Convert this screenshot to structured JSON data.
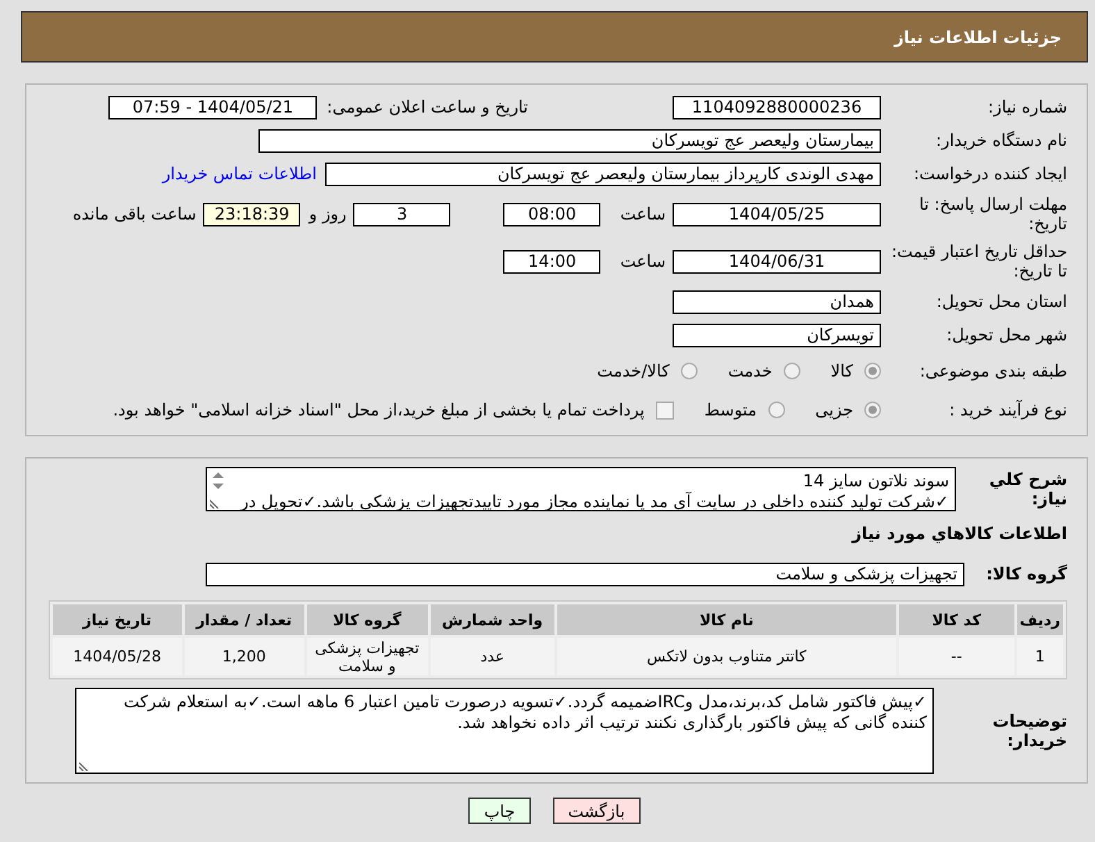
{
  "header": {
    "title": "جزئیات اطلاعات نیاز"
  },
  "need_number": {
    "label": "شماره نیاز:",
    "value": "1104092880000236"
  },
  "announce": {
    "label": "تاریخ و ساعت اعلان عمومی:",
    "value": "1404/05/21 - 07:59"
  },
  "buyer_org": {
    "label": "نام دستگاه خریدار:",
    "value": "بیمارستان ولیعصر  عج  تویسرکان"
  },
  "requester": {
    "label": "ایجاد کننده درخواست:",
    "value": "مهدی الوندی کارپرداز بیمارستان ولیعصر  عج  تویسرکان",
    "link": "اطلاعات تماس خریدار"
  },
  "reply_deadline": {
    "label": "مهلت ارسال پاسخ: تا تاریخ:",
    "date": "1404/05/25",
    "time_label": "ساعت",
    "time": "08:00",
    "days": "3",
    "days_label": "روز و",
    "remaining": "23:18:39",
    "remaining_label": "ساعت باقی مانده"
  },
  "price_validity": {
    "label": "حداقل تاریخ اعتبار قیمت: تا تاریخ:",
    "date": "1404/06/31",
    "time_label": "ساعت",
    "time": "14:00"
  },
  "province": {
    "label": "استان محل تحویل:",
    "value": "همدان"
  },
  "city": {
    "label": "شهر محل تحویل:",
    "value": "تویسرکان"
  },
  "category": {
    "label": "طبقه بندی موضوعی:",
    "options": [
      {
        "label": "کالا",
        "selected": true
      },
      {
        "label": "خدمت",
        "selected": false
      },
      {
        "label": "کالا/خدمت",
        "selected": false
      }
    ]
  },
  "purchase_process": {
    "label": "نوع فرآیند خرید :",
    "options": [
      {
        "label": "جزیی",
        "selected": true
      },
      {
        "label": "متوسط",
        "selected": false
      }
    ],
    "payment_note": {
      "checked": false,
      "text": "پرداخت تمام یا بخشی از مبلغ خرید،از محل \"اسناد خزانه اسلامی\" خواهد بود."
    }
  },
  "description": {
    "label": "شرح کلي نياز:",
    "lines": [
      "سوند نلاتون سایز 14",
      "✓شرکت تولید کننده داخلی در سایت آی مد یا نماینده مجاز مورد تاییدتجهیزات پزشکی باشد.✓تحویل در"
    ]
  },
  "goods_section": {
    "title": "اطلاعات کالاهاي مورد نياز",
    "group_label": "گروه کالا:",
    "group_value": "تجهیزات پزشکی و سلامت"
  },
  "table": {
    "columns": [
      "ردیف",
      "کد کالا",
      "نام کالا",
      "واحد شمارش",
      "گروه کالا",
      "تعداد / مقدار",
      "تاریخ نیاز"
    ],
    "rows": [
      {
        "cells": [
          "1",
          "--",
          "کاتتر متناوب بدون لاتکس",
          "عدد",
          "تجهیزات پزشکی و سلامت",
          "1,200",
          "1404/05/28"
        ]
      }
    ]
  },
  "buyer_notes": {
    "label": "توضیحات خریدار:",
    "text": "✓پیش فاکتور شامل کد،برند،مدل وIRCضمیمه گردد.✓تسویه درصورت تامین اعتبار 6 ماهه است.✓به استعلام شرکت کننده گانی که پیش فاکتور بارگذاری نکنند ترتیب اثر داده نخواهد شد."
  },
  "buttons": [
    {
      "label": "بازگشت",
      "kind": "back"
    },
    {
      "label": "چاپ",
      "kind": "print"
    }
  ]
}
